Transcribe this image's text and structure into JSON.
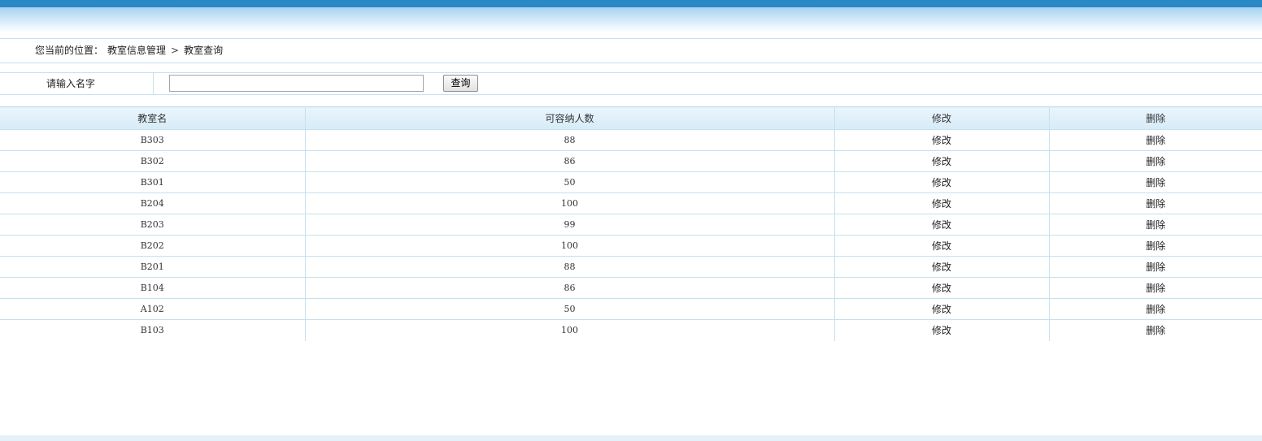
{
  "breadcrumb": {
    "label": "您当前的位置：",
    "section": "教室信息管理",
    "separator": ">",
    "current": "教室查询"
  },
  "search": {
    "label": "请输入名字",
    "value": "",
    "placeholder": "",
    "button_label": "查询"
  },
  "table": {
    "headers": [
      "教室名",
      "可容纳人数",
      "修改",
      "删除"
    ],
    "rows": [
      {
        "name": "B303",
        "capacity": "88",
        "edit": "修改",
        "delete": "删除"
      },
      {
        "name": "B302",
        "capacity": "86",
        "edit": "修改",
        "delete": "删除"
      },
      {
        "name": "B301",
        "capacity": "50",
        "edit": "修改",
        "delete": "删除"
      },
      {
        "name": "B204",
        "capacity": "100",
        "edit": "修改",
        "delete": "删除"
      },
      {
        "name": "B203",
        "capacity": "99",
        "edit": "修改",
        "delete": "删除"
      },
      {
        "name": "B202",
        "capacity": "100",
        "edit": "修改",
        "delete": "删除"
      },
      {
        "name": "B201",
        "capacity": "88",
        "edit": "修改",
        "delete": "删除"
      },
      {
        "name": "B104",
        "capacity": "86",
        "edit": "修改",
        "delete": "删除"
      },
      {
        "name": "A102",
        "capacity": "50",
        "edit": "修改",
        "delete": "删除"
      },
      {
        "name": "B103",
        "capacity": "100",
        "edit": "修改",
        "delete": "删除"
      }
    ]
  },
  "colors": {
    "top_bar": "#2a88c6",
    "border": "#c6e1ee",
    "header_bg": "#d6ebf8"
  }
}
